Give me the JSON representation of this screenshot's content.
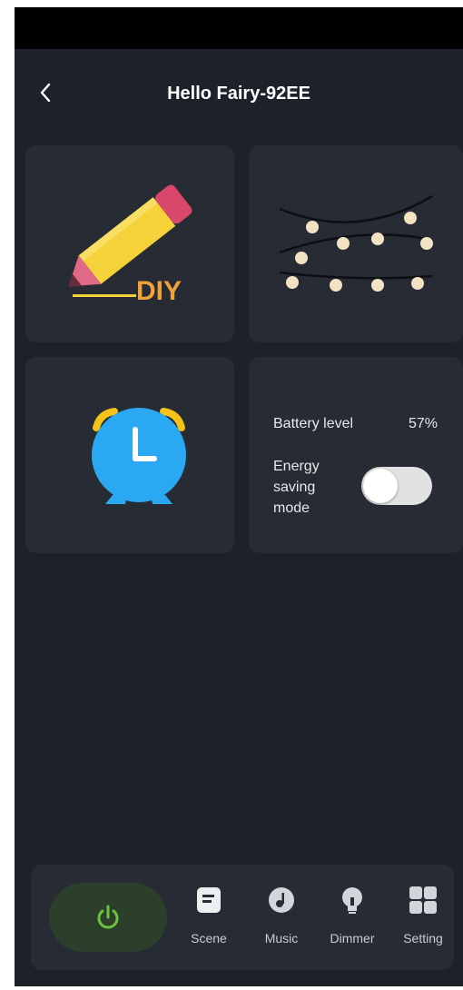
{
  "header": {
    "title": "Hello Fairy-92EE"
  },
  "cards": {
    "diy": {
      "label": "DIY",
      "icon": "pencil-icon"
    },
    "lights": {
      "icon": "string-lights-icon"
    },
    "timer": {
      "icon": "alarm-clock-icon"
    },
    "battery": {
      "battery_label": "Battery level",
      "battery_value": "57%",
      "energy_saving_label": "Energy saving mode",
      "energy_saving_enabled": false
    }
  },
  "bottom_nav": {
    "power_icon": "power-icon",
    "items": [
      {
        "label": "Scene",
        "icon": "scene-icon"
      },
      {
        "label": "Music",
        "icon": "music-icon"
      },
      {
        "label": "Dimmer",
        "icon": "bulb-icon"
      },
      {
        "label": "Setting",
        "icon": "grid-icon"
      }
    ]
  },
  "colors": {
    "background": "#1d2129",
    "card": "#272b33",
    "accent_orange": "#f0a23a",
    "power_green": "#6ec23f",
    "clock_blue": "#2aa8f2",
    "pencil_yellow": "#f5d23a",
    "pencil_pink": "#d9486a"
  }
}
